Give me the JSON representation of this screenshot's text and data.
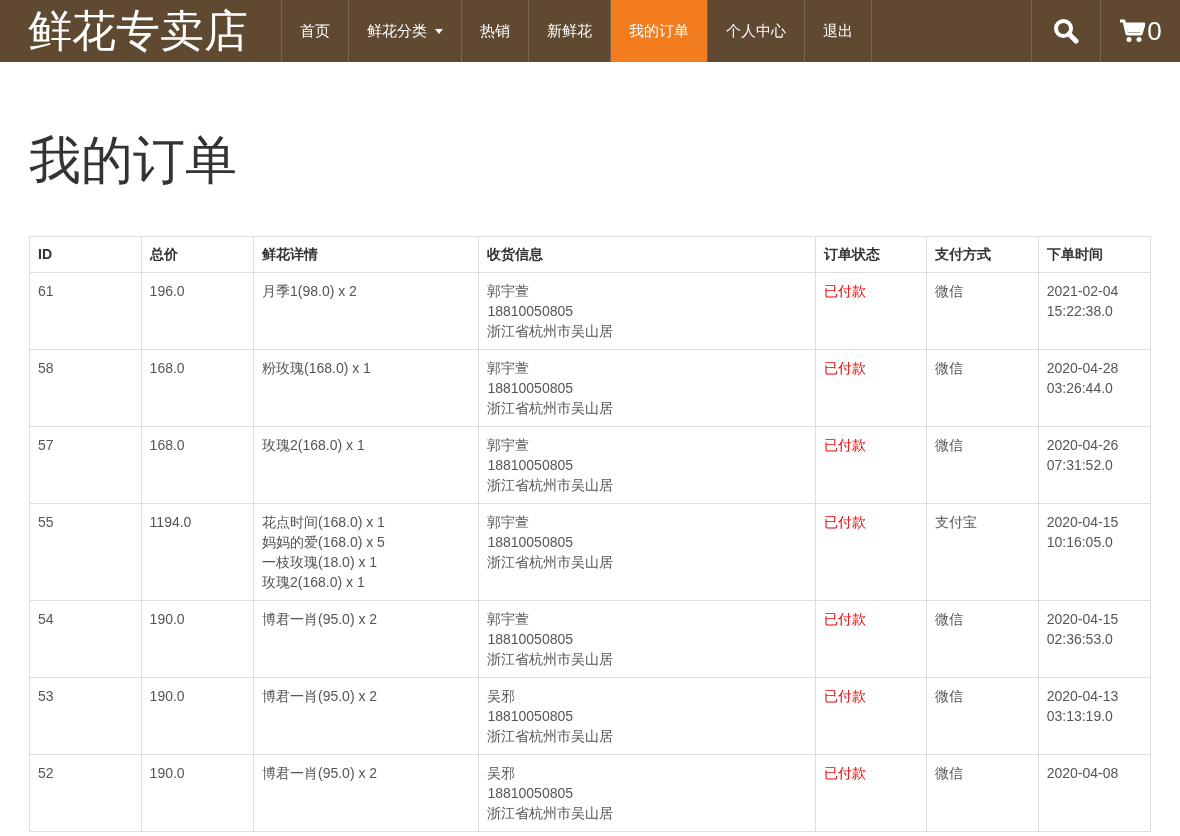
{
  "brand": "鲜花专卖店",
  "nav": [
    {
      "label": "首页",
      "selected": false,
      "dropdown": false
    },
    {
      "label": "鲜花分类",
      "selected": false,
      "dropdown": true
    },
    {
      "label": "热销",
      "selected": false,
      "dropdown": false
    },
    {
      "label": "新鲜花",
      "selected": false,
      "dropdown": false
    },
    {
      "label": "我的订单",
      "selected": true,
      "dropdown": false
    },
    {
      "label": "个人中心",
      "selected": false,
      "dropdown": false
    },
    {
      "label": "退出",
      "selected": false,
      "dropdown": false
    }
  ],
  "cart_count": "0",
  "page_title": "我的订单",
  "table": {
    "columns": [
      "ID",
      "总价",
      "鲜花详情",
      "收货信息",
      "订单状态",
      "支付方式",
      "下单时间"
    ],
    "rows": [
      {
        "id": "61",
        "total": "196.0",
        "items": [
          "月季1(98.0) x 2"
        ],
        "receiver": [
          "郭宇萱",
          "18810050805",
          "浙江省杭州市吴山居"
        ],
        "status": "已付款",
        "payment": "微信",
        "time": [
          "2021-02-04",
          "15:22:38.0"
        ]
      },
      {
        "id": "58",
        "total": "168.0",
        "items": [
          "粉玫瑰(168.0) x 1"
        ],
        "receiver": [
          "郭宇萱",
          "18810050805",
          "浙江省杭州市吴山居"
        ],
        "status": "已付款",
        "payment": "微信",
        "time": [
          "2020-04-28",
          "03:26:44.0"
        ]
      },
      {
        "id": "57",
        "total": "168.0",
        "items": [
          "玫瑰2(168.0) x 1"
        ],
        "receiver": [
          "郭宇萱",
          "18810050805",
          "浙江省杭州市吴山居"
        ],
        "status": "已付款",
        "payment": "微信",
        "time": [
          "2020-04-26",
          "07:31:52.0"
        ]
      },
      {
        "id": "55",
        "total": "1194.0",
        "items": [
          "花点时间(168.0) x 1",
          "妈妈的爱(168.0) x 5",
          "一枝玫瑰(18.0) x 1",
          "玫瑰2(168.0) x 1"
        ],
        "receiver": [
          "郭宇萱",
          "18810050805",
          "浙江省杭州市吴山居"
        ],
        "status": "已付款",
        "payment": "支付宝",
        "time": [
          "2020-04-15",
          "10:16:05.0"
        ]
      },
      {
        "id": "54",
        "total": "190.0",
        "items": [
          "博君一肖(95.0) x 2"
        ],
        "receiver": [
          "郭宇萱",
          "18810050805",
          "浙江省杭州市吴山居"
        ],
        "status": "已付款",
        "payment": "微信",
        "time": [
          "2020-04-15",
          "02:36:53.0"
        ]
      },
      {
        "id": "53",
        "total": "190.0",
        "items": [
          "博君一肖(95.0) x 2"
        ],
        "receiver": [
          "吴邪",
          "18810050805",
          "浙江省杭州市吴山居"
        ],
        "status": "已付款",
        "payment": "微信",
        "time": [
          "2020-04-13",
          "03:13:19.0"
        ]
      },
      {
        "id": "52",
        "total": "190.0",
        "items": [
          "博君一肖(95.0) x 2"
        ],
        "receiver": [
          "吴邪",
          "18810050805",
          "浙江省杭州市吴山居"
        ],
        "status": "已付款",
        "payment": "微信",
        "time": [
          "2020-04-08"
        ]
      }
    ]
  }
}
